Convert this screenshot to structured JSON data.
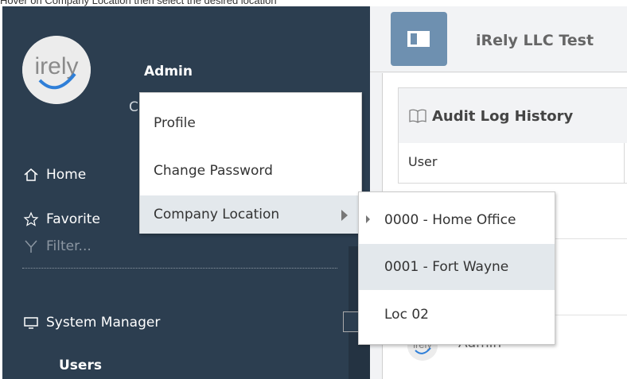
{
  "caption": "Hover on Company Location then select the desired location",
  "sidebar": {
    "user_name": "Admin",
    "user_sub": "C",
    "nav": {
      "home": "Home",
      "favorites": "Favorite",
      "filter_placeholder": "Filter...",
      "system_manager": "System Manager",
      "users": "Users"
    }
  },
  "header": {
    "app_title": "iRely LLC Test"
  },
  "panel": {
    "title": "Audit Log History",
    "column_user": "User",
    "row_user": "Admin"
  },
  "user_menu": {
    "items": [
      "Profile",
      "Change Password",
      "Company Location"
    ]
  },
  "location_submenu": {
    "items": [
      "0000 - Home Office",
      "0001 - Fort Wayne",
      "Loc 02"
    ],
    "current": "0000 - Home Office",
    "hovered": "0001 - Fort Wayne"
  },
  "colors": {
    "sidebar": "#2c3e50",
    "accent": "#6e90b0",
    "highlight": "#e3e8ec"
  }
}
